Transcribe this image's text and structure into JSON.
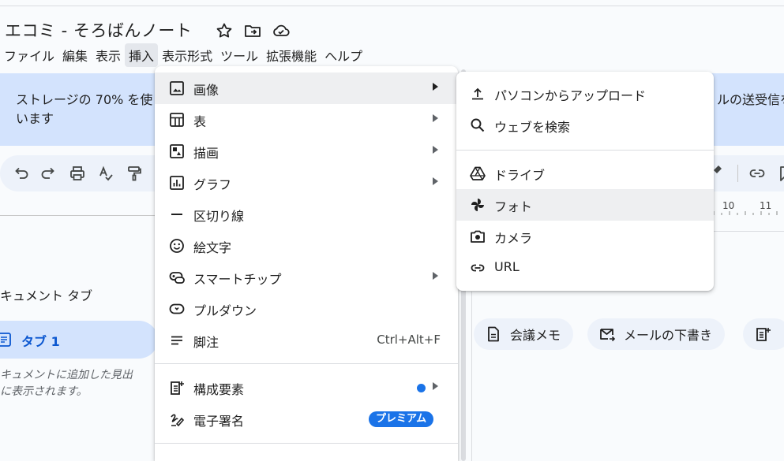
{
  "document": {
    "title": "エコミ - そろばんノート"
  },
  "title_icons": [
    "star-icon",
    "move-to-folder-icon",
    "cloud-status-icon"
  ],
  "menubar": {
    "items": [
      "ファイル",
      "編集",
      "表示",
      "挿入",
      "表示形式",
      "ツール",
      "拡張機能",
      "ヘルプ"
    ],
    "active": "挿入"
  },
  "banner": {
    "left_line1": "ストレージの 70% を使",
    "left_line2": "います",
    "right_line1": "ルの送受信を"
  },
  "toolbar": {
    "left_icons": [
      "undo-icon",
      "redo-icon",
      "print-icon",
      "spellcheck-icon",
      "paint-format-icon"
    ],
    "right_icons": [
      "highlighter-icon",
      "link-icon",
      "comment-icon"
    ]
  },
  "ruler": {
    "labels": [
      "10",
      "11"
    ]
  },
  "sidebar": {
    "tabs_heading": "キュメント タブ",
    "tab1_label": "タブ 1",
    "hint_line1": "キュメントに追加した見出",
    "hint_line2": "に表示されます。"
  },
  "chips": [
    {
      "label": "会議メモ",
      "icon": "document-icon"
    },
    {
      "label": "メールの下書き",
      "icon": "email-draft-icon"
    },
    {
      "label": "",
      "icon": "more-templates-icon"
    }
  ],
  "insert_menu": {
    "items": [
      {
        "label": "画像",
        "icon": "image-icon",
        "submenu": true,
        "highlighted": true
      },
      {
        "label": "表",
        "icon": "table-icon",
        "submenu": true
      },
      {
        "label": "描画",
        "icon": "drawing-icon",
        "submenu": true
      },
      {
        "label": "グラフ",
        "icon": "chart-icon",
        "submenu": true
      },
      {
        "label": "区切り線",
        "icon": "horizontal-line-icon"
      },
      {
        "label": "絵文字",
        "icon": "emoji-icon"
      },
      {
        "label": "スマートチップ",
        "icon": "smart-chip-icon",
        "submenu": true
      },
      {
        "label": "プルダウン",
        "icon": "dropdown-icon"
      },
      {
        "label": "脚注",
        "icon": "footnote-icon",
        "shortcut": "Ctrl+Alt+F"
      },
      {
        "label": "構成要素",
        "icon": "building-blocks-icon",
        "submenu": true,
        "new_dot": true
      },
      {
        "label": "電子署名",
        "icon": "esignature-icon",
        "badge": "プレミアム"
      }
    ]
  },
  "image_submenu": {
    "items": [
      {
        "label": "パソコンからアップロード",
        "icon": "upload-icon"
      },
      {
        "label": "ウェブを検索",
        "icon": "search-icon"
      },
      {
        "label": "ドライブ",
        "icon": "drive-icon"
      },
      {
        "label": "フォト",
        "icon": "photos-icon",
        "highlighted": true
      },
      {
        "label": "カメラ",
        "icon": "camera-icon"
      },
      {
        "label": "URL",
        "icon": "link-icon"
      }
    ]
  },
  "colors": {
    "banner_bg": "#d3e3fd",
    "toolbar_bg": "#edf2fa",
    "accent_blue": "#1a73e8",
    "tab_text": "#0b57d0",
    "menu_highlight": "#eeeff1"
  }
}
